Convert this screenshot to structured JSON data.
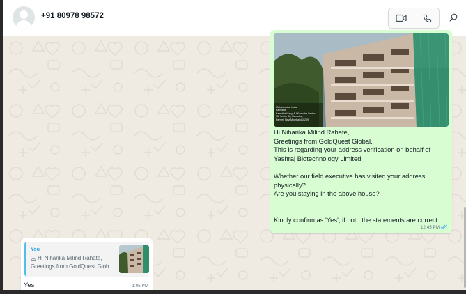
{
  "header": {
    "contact_name": "+91 80978 98572",
    "icons": [
      "avatar",
      "video-call-icon",
      "voice-call-icon",
      "search-icon"
    ]
  },
  "messages": {
    "outgoing": {
      "image_caption_lines": [
        "Maharashtra, India",
        "Kamothe",
        "Kamothe Marg, A.I Kamothe Sector - 36, Sector 36, Kamothe,",
        "Panvel, Navi Mumbai 410209"
      ],
      "text": "Hi Niharika Milind Rahate,\nGreetings from GoldQuest Global.\nThis is regarding your address verification on behalf of Yashraj Biotechnology Limited\n\nWhether our field executive has visited your address physically?\nAre you staying in the above house?\n\n\nKindly confirm as 'Yes', if both the statements are correct",
      "time": "12:45 PM",
      "status": "read",
      "tick_color": "#53bdeb"
    },
    "incoming": {
      "quote_author": "You",
      "quote_line1": "Hi Niharika Milind Rahate,",
      "quote_line2": "Greetings from GoldQuest Glob...",
      "text": "Yes",
      "time": "1:05 PM"
    }
  },
  "colors": {
    "chat_bg": "#efeae2",
    "outgoing_bubble": "#d9fdd3",
    "incoming_bubble": "#ffffff",
    "quote_accent": "#53bdeb"
  }
}
